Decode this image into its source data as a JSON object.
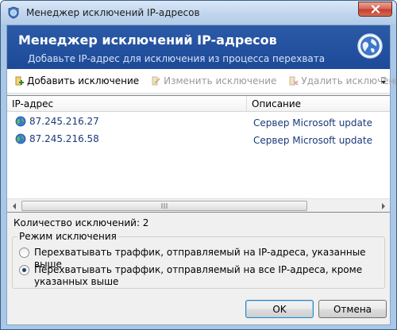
{
  "window": {
    "title": "Менеджер исключений IP-адресов"
  },
  "banner": {
    "title": "Менеджер исключений IP-адресов",
    "subtitle": "Добавьте IP-адрес для исключения из процесса перехвата"
  },
  "toolbar": {
    "add_label": "Добавить исключение",
    "edit_label": "Изменить исключение",
    "delete_label": "Удалить исключение"
  },
  "list": {
    "columns": [
      "IP-адрес",
      "Описание"
    ],
    "rows": [
      {
        "ip": "87.245.216.27",
        "description": "Сервер Microsoft update"
      },
      {
        "ip": "87.245.216.58",
        "description": "Сервер Microsoft update"
      }
    ]
  },
  "count_label": "Количество исключений: 2",
  "mode": {
    "label": "Режим исключения",
    "options": [
      {
        "label": "Перехватывать траффик, отправляемый на IP-адреса, указанные выше",
        "checked": false
      },
      {
        "label": "Перехватывать траффик, отправляемый на все IP-адреса, кроме указанных выше",
        "checked": true
      }
    ]
  },
  "buttons": {
    "ok": "OK",
    "cancel": "Отмена"
  },
  "colors": {
    "banner": "#1d4a98",
    "link_text": "#1a3a7a",
    "close_button": "#c4402e"
  }
}
